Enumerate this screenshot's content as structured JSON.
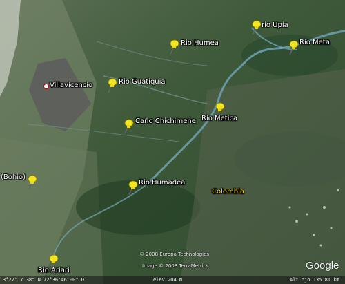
{
  "map": {
    "colors": {
      "vegetation": "#3b5e36",
      "plains": "#6f7f63",
      "river": "#6fa3b5",
      "city_overlay": "#5a5a5a",
      "pin": "#f3e51f",
      "label": "#ffffff",
      "country_label": "#ffd51a"
    },
    "places": [
      {
        "id": "villavicencio",
        "label": "Villavicencio",
        "icon": "city-dot-icon"
      },
      {
        "id": "rio-upia",
        "label": "rio Upia",
        "icon": "yellow-pushpin-icon"
      },
      {
        "id": "rio-meta",
        "label": "Rio Meta",
        "icon": "yellow-pushpin-icon"
      },
      {
        "id": "rio-humea",
        "label": "Rio Humea",
        "icon": "yellow-pushpin-icon"
      },
      {
        "id": "rio-guatiquia",
        "label": "Rio Guatiquia",
        "icon": "yellow-pushpin-icon"
      },
      {
        "id": "rio-metica",
        "label": "Rio Metica",
        "icon": "yellow-pushpin-icon"
      },
      {
        "id": "cano-chichimene",
        "label": "Caño Chichimene",
        "icon": "yellow-pushpin-icon"
      },
      {
        "id": "bohio",
        "label": "(Bohio)",
        "icon": "yellow-pushpin-icon"
      },
      {
        "id": "rio-humadea",
        "label": "Rio Humadea",
        "icon": "yellow-pushpin-icon"
      },
      {
        "id": "rio-ariari",
        "label": "Rio Ariari",
        "icon": "yellow-pushpin-icon"
      }
    ],
    "country_label": "Colombia",
    "credits": {
      "line1": "© 2008 Europa Technologies",
      "line2": "Image © 2008 TerraMetrics"
    },
    "brand": "Google",
    "status": {
      "coords": "3°27'17.38\" N    72°36'46.00\" O",
      "elev": "elev  204 m",
      "eye": "Alt ojo  135.81 km"
    }
  }
}
